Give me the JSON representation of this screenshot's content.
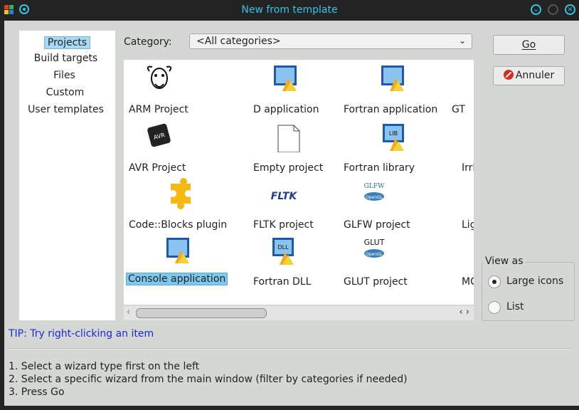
{
  "window": {
    "title": "New from template"
  },
  "categories": {
    "items": [
      "Projects",
      "Build targets",
      "Files",
      "Custom",
      "User templates"
    ],
    "selected": "Projects"
  },
  "filter": {
    "label": "Category:",
    "value": "<All categories>"
  },
  "templates": [
    {
      "label": "ARM Project",
      "icon": "gnu-icon"
    },
    {
      "label": "D application",
      "icon": "wizard-icon"
    },
    {
      "label": "Fortran application",
      "icon": "wizard-icon"
    },
    {
      "label": "GT",
      "icon": "none"
    },
    {
      "label": "AVR Project",
      "icon": "avr-chip-icon"
    },
    {
      "label": "Empty project",
      "icon": "blank-file-icon"
    },
    {
      "label": "Fortran library",
      "icon": "lib-icon"
    },
    {
      "label": "Irrl",
      "icon": "none"
    },
    {
      "label": "Code::Blocks plugin",
      "icon": "puzzle-icon"
    },
    {
      "label": "FLTK project",
      "icon": "fltk-icon"
    },
    {
      "label": "GLFW project",
      "icon": "glfw-icon"
    },
    {
      "label": "Lig",
      "icon": "none"
    },
    {
      "label": "Console application",
      "icon": "wizard-icon",
      "selected": true
    },
    {
      "label": "Fortran DLL",
      "icon": "dll-icon"
    },
    {
      "label": "GLUT project",
      "icon": "glut-icon"
    },
    {
      "label": "MC",
      "icon": "none"
    }
  ],
  "icon_text": {
    "avr": "AVR",
    "lib": "LIB",
    "dll": "DLL",
    "fltk": "FLTK",
    "glfw": "GLFW",
    "glut": "GLUT",
    "opengl": "OpenGL"
  },
  "buttons": {
    "go": "Go",
    "cancel": "Annuler"
  },
  "view_as": {
    "label": "View as",
    "options": [
      "Large icons",
      "List"
    ],
    "selected": "Large icons"
  },
  "tip": "TIP: Try right-clicking an item",
  "instructions": [
    "1. Select a wizard type first on the left",
    "2. Select a specific wizard from the main window (filter by categories if needed)",
    "3. Press Go"
  ],
  "colors": {
    "titlebar": "#232323",
    "title_text": "#33c6e8",
    "tip": "#1a2ad8",
    "selection": "#7ec7ef"
  }
}
